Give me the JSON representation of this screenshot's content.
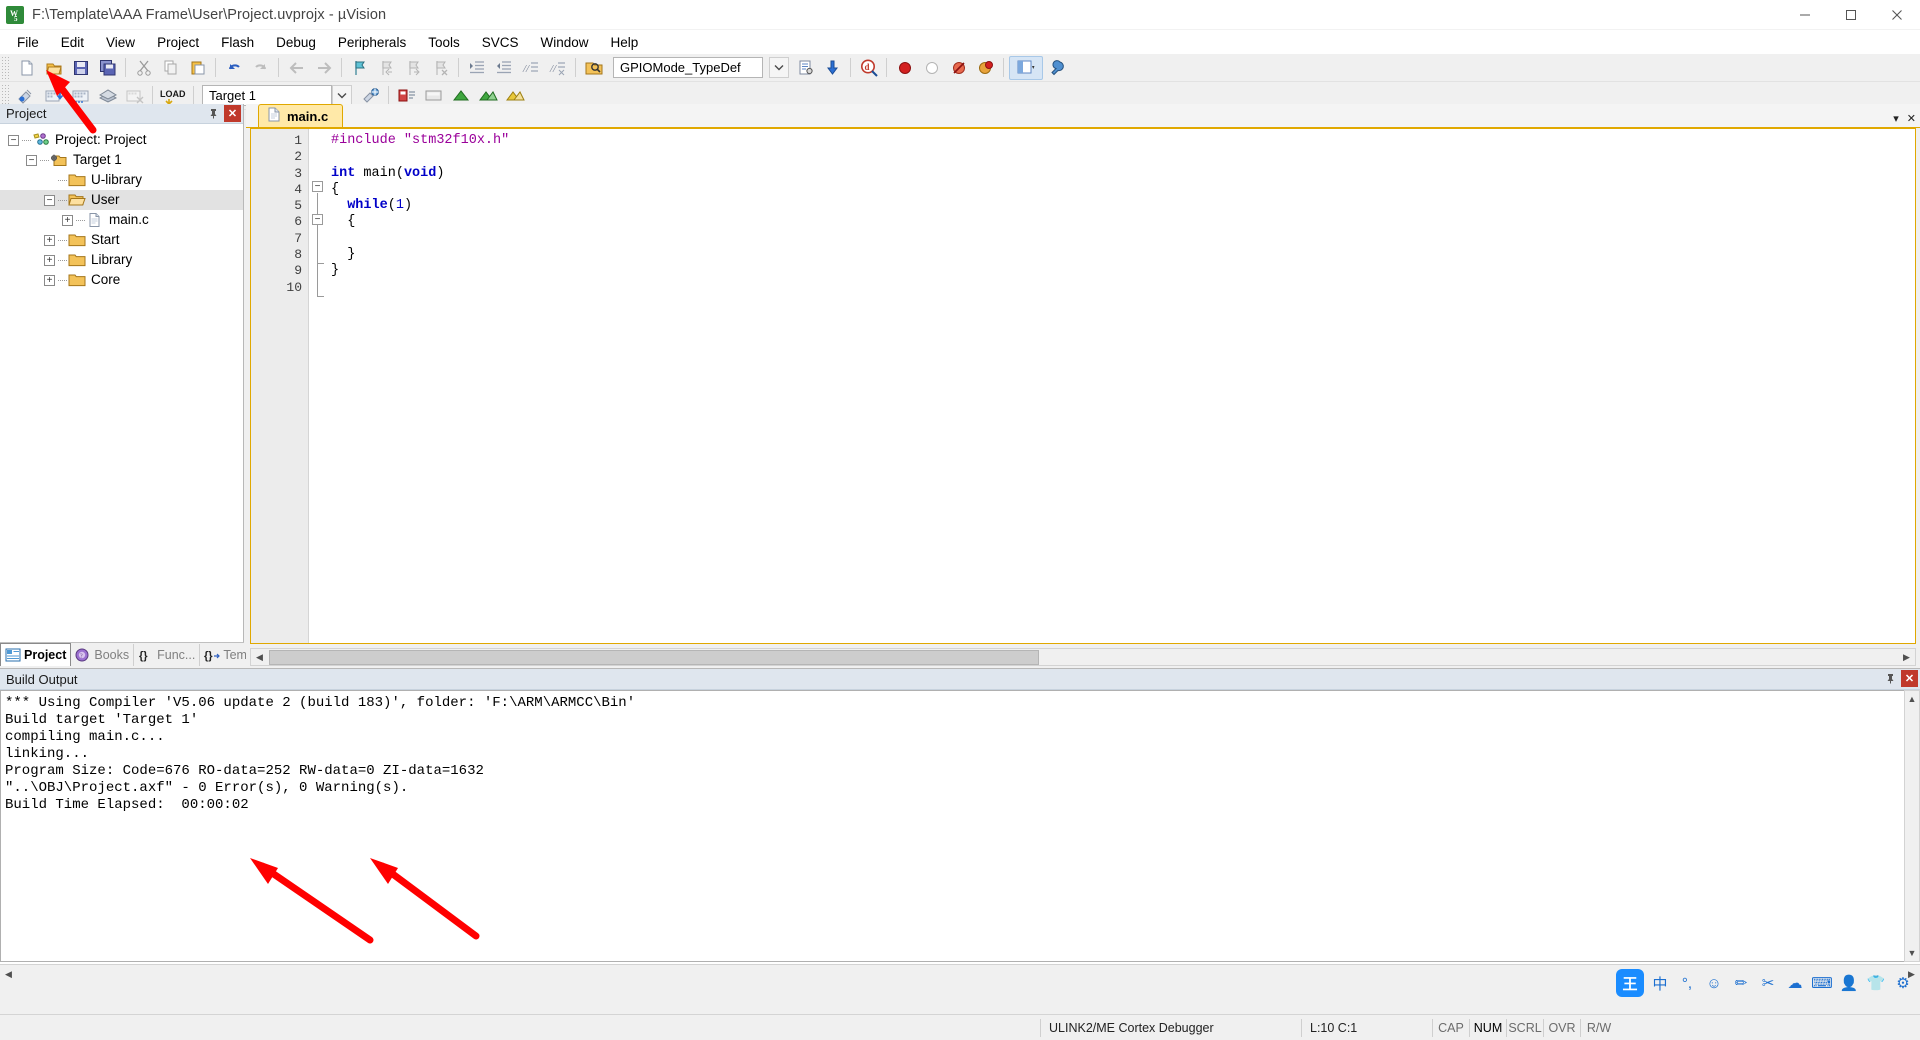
{
  "window": {
    "title": "F:\\Template\\AAA Frame\\User\\Project.uvprojx - µVision",
    "app_icon": "uvision-icon",
    "minimize": "minimize-button",
    "maximize": "maximize-button",
    "close": "close-button"
  },
  "menu": {
    "items": [
      "File",
      "Edit",
      "View",
      "Project",
      "Flash",
      "Debug",
      "Peripherals",
      "Tools",
      "SVCS",
      "Window",
      "Help"
    ]
  },
  "toolbar_main": {
    "buttons": [
      "new-file-icon",
      "open-file-icon",
      "save-icon",
      "save-all-icon",
      "cut-icon",
      "copy-icon",
      "paste-icon",
      "undo-icon",
      "redo-icon",
      "navigate-back-icon",
      "navigate-forward-icon",
      "insert-bookmark-icon",
      "prev-bookmark-icon",
      "next-bookmark-icon",
      "clear-bookmarks-icon",
      "indent-icon",
      "outdent-icon",
      "comment-icon",
      "uncomment-icon",
      "find-in-files-icon"
    ],
    "search_value": "GPIOMode_TypeDef",
    "search_placeholder": "",
    "after_search": [
      "dropdown-arrow-icon",
      "browse-symbols-icon",
      "find-next-icon",
      "find-icon"
    ],
    "debug_buttons": [
      "insert-breakpoint-icon",
      "disable-breakpoint-icon",
      "kill-all-breakpoints-icon",
      "disable-all-breakpoints-icon"
    ],
    "window_select": "window-layout-icon",
    "config_button": "configuration-wizard-icon"
  },
  "toolbar_build": {
    "buttons": [
      "translate-icon",
      "build-icon",
      "rebuild-icon",
      "batch-build-icon",
      "stop-build-icon",
      "download-icon"
    ],
    "target_value": "Target 1",
    "target_dropdown": "target-dropdown-arrow",
    "after_target": [
      "options-target-icon",
      "manage-project-items-icon",
      "manage-run-time-env-icon",
      "pack-installer-icon",
      "svcs-icon",
      "pack-icon"
    ]
  },
  "project_panel": {
    "caption": "Project",
    "pin": "pin-icon",
    "close": "close-icon",
    "tree": [
      {
        "label": "Project: Project",
        "level": 0,
        "expander": "-",
        "icon": "project-icon",
        "selected": false
      },
      {
        "label": "Target 1",
        "level": 1,
        "expander": "-",
        "icon": "target-icon",
        "selected": false
      },
      {
        "label": "U-library",
        "level": 2,
        "expander": "",
        "icon": "folder-icon",
        "selected": false
      },
      {
        "label": "User",
        "level": 2,
        "expander": "-",
        "icon": "folder-open-icon",
        "selected": true
      },
      {
        "label": "main.c",
        "level": 3,
        "expander": "+",
        "icon": "c-file-icon",
        "selected": false
      },
      {
        "label": "Start",
        "level": 2,
        "expander": "+",
        "icon": "folder-icon",
        "selected": false
      },
      {
        "label": "Library",
        "level": 2,
        "expander": "+",
        "icon": "folder-icon",
        "selected": false
      },
      {
        "label": "Core",
        "level": 2,
        "expander": "+",
        "icon": "folder-icon",
        "selected": false
      }
    ],
    "tabs": [
      {
        "label": "Project",
        "icon": "project-tab-icon",
        "active": true
      },
      {
        "label": "Books",
        "icon": "books-tab-icon",
        "active": false
      },
      {
        "label": "Func...",
        "icon": "functions-tab-icon",
        "active": false
      },
      {
        "label": "Tem...",
        "icon": "templates-tab-icon",
        "active": false
      }
    ]
  },
  "editor": {
    "tab": {
      "label": "main.c",
      "icon": "c-file-icon"
    },
    "tab_menu": "document-list-icon",
    "tab_close": "close-document-icon",
    "line_numbers": [
      "1",
      "2",
      "3",
      "4",
      "5",
      "6",
      "7",
      "8",
      "9",
      "10"
    ],
    "code_lines": [
      {
        "n": 1,
        "tokens": [
          {
            "t": "#include ",
            "c": "pp"
          },
          {
            "t": "\"stm32f10x.h\"",
            "c": "str"
          }
        ]
      },
      {
        "n": 2,
        "tokens": []
      },
      {
        "n": 3,
        "tokens": [
          {
            "t": "int",
            "c": "kw"
          },
          {
            "t": " main",
            "c": "fn"
          },
          {
            "t": "(",
            "c": "fn"
          },
          {
            "t": "void",
            "c": "kw"
          },
          {
            "t": ")",
            "c": "fn"
          }
        ]
      },
      {
        "n": 4,
        "tokens": [
          {
            "t": "{",
            "c": "fn"
          }
        ]
      },
      {
        "n": 5,
        "tokens": [
          {
            "t": "  ",
            "c": "fn"
          },
          {
            "t": "while",
            "c": "kw"
          },
          {
            "t": "(",
            "c": "fn"
          },
          {
            "t": "1",
            "c": "num"
          },
          {
            "t": ")",
            "c": "fn"
          }
        ]
      },
      {
        "n": 6,
        "tokens": [
          {
            "t": "  {",
            "c": "fn"
          }
        ]
      },
      {
        "n": 7,
        "tokens": []
      },
      {
        "n": 8,
        "tokens": [
          {
            "t": "  }",
            "c": "fn"
          }
        ]
      },
      {
        "n": 9,
        "tokens": [
          {
            "t": "}",
            "c": "fn"
          }
        ]
      },
      {
        "n": 10,
        "tokens": []
      }
    ]
  },
  "build_output": {
    "caption": "Build Output",
    "pin": "pin-icon",
    "close": "close-icon",
    "lines": [
      "*** Using Compiler 'V5.06 update 2 (build 183)', folder: 'F:\\ARM\\ARMCC\\Bin'",
      "Build target 'Target 1'",
      "compiling main.c...",
      "linking...",
      "Program Size: Code=676 RO-data=252 RW-data=0 ZI-data=1632",
      "\"..\\OBJ\\Project.axf\" - 0 Error(s), 0 Warning(s).",
      "Build Time Elapsed:  00:00:02"
    ]
  },
  "statusbar": {
    "debugger": "ULINK2/ME Cortex Debugger",
    "cursor": "L:10 C:1",
    "flags": [
      {
        "label": "CAP",
        "on": false
      },
      {
        "label": "NUM",
        "on": true
      },
      {
        "label": "SCRL",
        "on": false
      },
      {
        "label": "OVR",
        "on": false
      },
      {
        "label": "R/W",
        "on": false
      }
    ]
  },
  "ime": {
    "logo": "王",
    "icons": [
      "中",
      "°,",
      "☺",
      "✏",
      "✂",
      "☁",
      "⌨",
      "👤",
      "👕",
      "⚙"
    ]
  },
  "colors": {
    "accent_tab": "#ffe9a8",
    "accent_border": "#e0a800",
    "panel_caption": "#dfe6ee",
    "annotation": "#ff0000",
    "keyword": "#0000c8",
    "string": "#9a009a"
  }
}
